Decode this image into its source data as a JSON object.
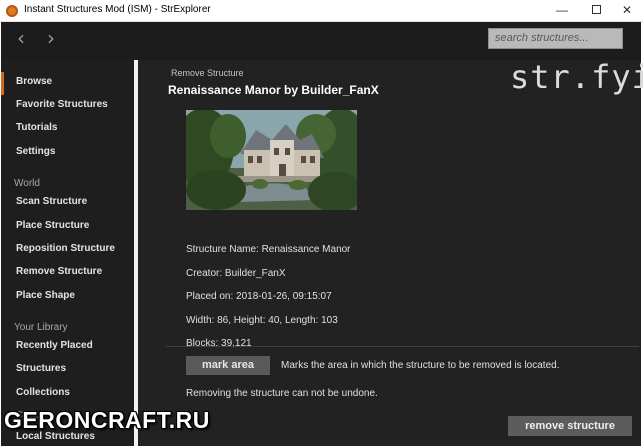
{
  "window": {
    "title": "Instant Structures Mod (ISM) - StrExplorer",
    "minimize_glyph": "—",
    "close_glyph": "✕"
  },
  "topbar": {
    "back_glyph": "‹",
    "forward_glyph": "›",
    "search_placeholder": "search structures..."
  },
  "sidebar": {
    "items_top": [
      "Browse",
      "Favorite Structures",
      "Tutorials",
      "Settings"
    ],
    "world_heading": "World",
    "items_world": [
      "Scan Structure",
      "Place Structure",
      "Reposition Structure",
      "Remove Structure",
      "Place Shape"
    ],
    "library_heading": "Your Library",
    "items_library": [
      "Recently Placed",
      "Structures",
      "Collections",
      "Crea",
      "Local Structures"
    ]
  },
  "main": {
    "breadcrumb": "Remove Structure",
    "heading": "Renaissance Manor by Builder_FanX",
    "logo": "str.fyi/",
    "details": {
      "name": "Structure Name: Renaissance Manor",
      "creator": "Creator: Builder_FanX",
      "placed": "Placed on: 2018-01-26, 09:15:07",
      "size": "Width: 86, Height: 40, Length: 103",
      "blocks": "Blocks: 39,121"
    },
    "mark_button": "mark area",
    "mark_hint": "Marks the area in which the structure to be removed is located.",
    "warning": "Removing the structure can not be undone.",
    "remove_button": "remove structure"
  },
  "watermark": "GERONCRAFT.RU",
  "colors": {
    "accent": "#d36a1e",
    "background": "#222222",
    "sidebar": "#1e1e1e",
    "button": "#5a5a5a"
  }
}
